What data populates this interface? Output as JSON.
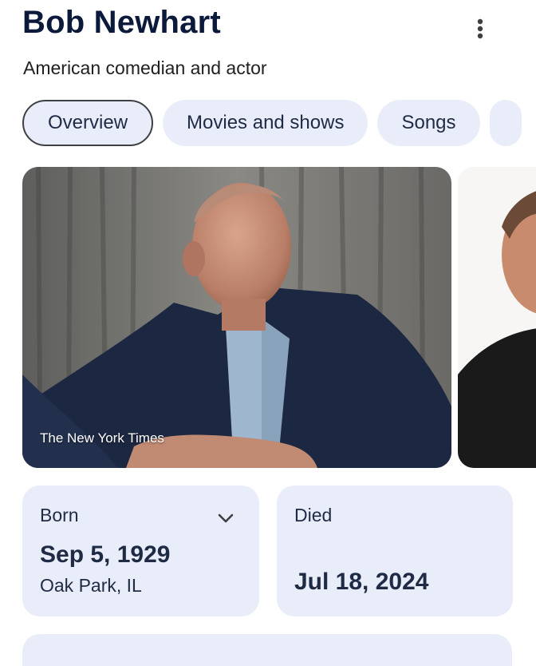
{
  "header": {
    "title": "Bob Newhart",
    "subtitle": "American comedian and actor"
  },
  "tabs": [
    {
      "label": "Overview",
      "active": true
    },
    {
      "label": "Movies and shows",
      "active": false
    },
    {
      "label": "Songs",
      "active": false
    }
  ],
  "gallery": {
    "main_caption": "The New York Times"
  },
  "facts": {
    "born": {
      "label": "Born",
      "date": "Sep 5, 1929",
      "place": "Oak Park, IL"
    },
    "died": {
      "label": "Died",
      "date": "Jul 18, 2024"
    }
  },
  "icons": {
    "more": "more-vert-icon",
    "expand": "chevron-down-icon"
  },
  "colors": {
    "accent_bg": "#e9edf9",
    "title": "#0b1a3a",
    "text": "#1f2a44"
  }
}
